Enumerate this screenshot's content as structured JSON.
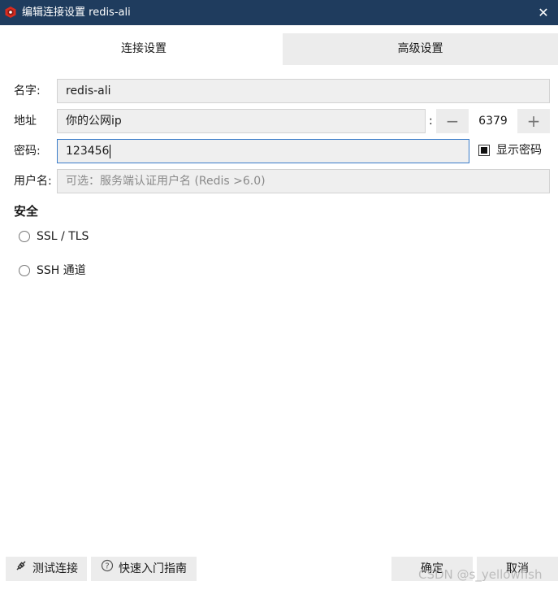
{
  "window": {
    "title": "编辑连接设置 redis-ali",
    "close_symbol": "✕",
    "icon": "redis-logo-icon"
  },
  "tabs": [
    {
      "label": "连接设置",
      "active": true
    },
    {
      "label": "高级设置",
      "active": false
    }
  ],
  "form": {
    "name_label": "名字:",
    "name_value": "redis-ali",
    "address_label": "地址",
    "address_value": "你的公网ip",
    "port_separator": ":",
    "port_value": "6379",
    "port_decrement": "−",
    "port_increment": "+",
    "password_label": "密码:",
    "password_value": "123456",
    "show_password_label": "显示密码",
    "show_password_checked": true,
    "username_label": "用户名:",
    "username_placeholder": "可选：服务端认证用户名 (Redis >6.0)"
  },
  "security": {
    "title": "安全",
    "options": [
      {
        "label": "SSL / TLS",
        "selected": false
      },
      {
        "label": "SSH 通道",
        "selected": false
      }
    ]
  },
  "footer": {
    "test_connection": "测试连接",
    "quick_start": "快速入门指南",
    "ok": "确定",
    "cancel": "取消"
  },
  "watermark": "CSDN @s_yellowfish",
  "colors": {
    "titlebar": "#1f3c5e",
    "focus_border": "#3a7cc9",
    "redis_red": "#d82c20"
  }
}
